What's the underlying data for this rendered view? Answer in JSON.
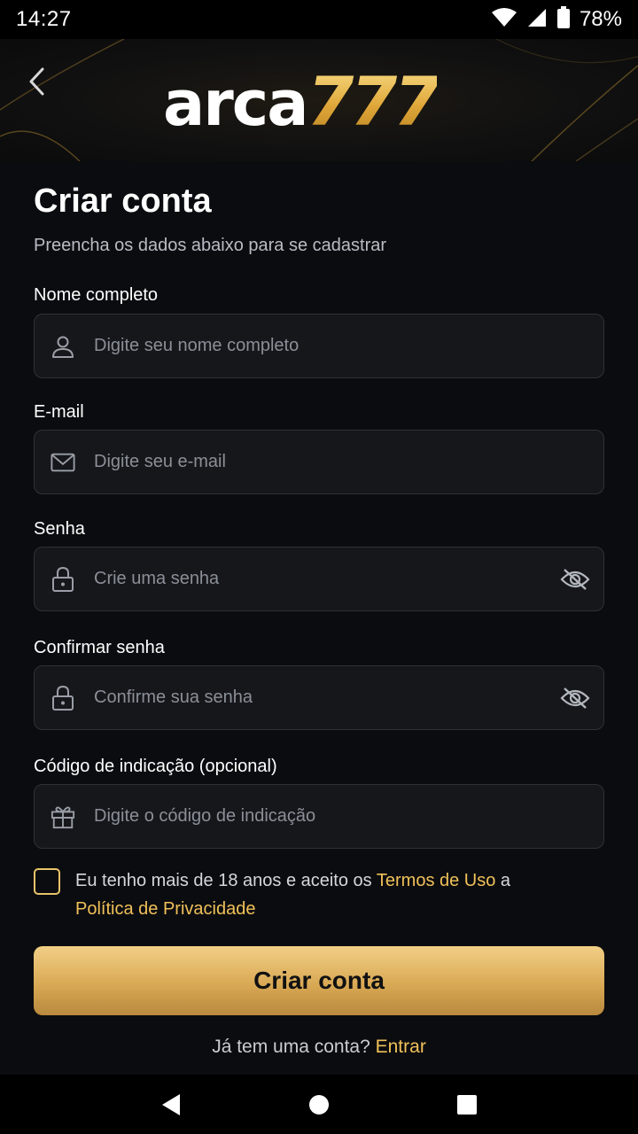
{
  "status_bar": {
    "time": "14:27",
    "battery": "78%"
  },
  "header": {
    "brand_text": "arca",
    "brand_number": "777"
  },
  "form": {
    "title": "Criar conta",
    "subtitle": "Preencha os dados abaixo para se cadastrar",
    "fields": [
      {
        "label": "Nome completo",
        "placeholder": "Digite seu nome completo",
        "value": "",
        "icon": "user-icon"
      },
      {
        "label": "E-mail",
        "placeholder": "Digite seu e-mail",
        "value": "",
        "icon": "mail-icon"
      },
      {
        "label": "Senha",
        "placeholder": "Crie uma senha",
        "value": "",
        "icon": "lock-icon"
      },
      {
        "label": "Confirmar senha",
        "placeholder": "Confirme sua senha",
        "value": "",
        "icon": "lock-icon"
      },
      {
        "label": "Código de indicação (opcional)",
        "placeholder": "Digite o código de indicação",
        "value": "",
        "icon": "gift-icon"
      }
    ],
    "terms": {
      "checked": false,
      "text_before": "Eu tenho mais de 18 anos e aceito os ",
      "terms_link": "Termos de Uso",
      "text_middle": " a ",
      "privacy_link": "Política de Privacidade"
    },
    "submit_label": "Criar conta",
    "login_prompt": "Já tem uma conta?",
    "login_link": "Entrar"
  },
  "colors": {
    "accent_gold": "#f0c05a",
    "background": "#0b0c0f",
    "field_bg": "#15171b"
  }
}
